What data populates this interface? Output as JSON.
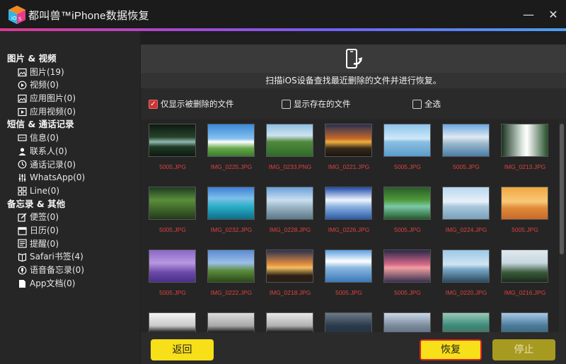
{
  "app": {
    "title": "都叫兽™iPhone数据恢复"
  },
  "colors": {
    "accent_yellow": "#f7df19",
    "filename_red": "#e04040",
    "sidebar_bg": "#262626",
    "main_bg": "#252525"
  },
  "sidebar": {
    "groups": [
      {
        "label": "图片 & 视频",
        "items": [
          {
            "label": "图片(19)",
            "icon": "image-icon"
          },
          {
            "label": "视频(0)",
            "icon": "play-circle-icon"
          },
          {
            "label": "应用图片(0)",
            "icon": "app-image-icon"
          },
          {
            "label": "应用视频(0)",
            "icon": "app-video-icon"
          }
        ]
      },
      {
        "label": "短信 & 通话记录",
        "items": [
          {
            "label": "信息(0)",
            "icon": "message-icon"
          },
          {
            "label": "联系人(0)",
            "icon": "person-icon"
          },
          {
            "label": "通话记录(0)",
            "icon": "clock-icon"
          },
          {
            "label": "WhatsApp(0)",
            "icon": "sliders-icon"
          },
          {
            "label": "Line(0)",
            "icon": "grid-icon"
          }
        ]
      },
      {
        "label": "备忘录 & 其他",
        "items": [
          {
            "label": "便签(0)",
            "icon": "note-edit-icon"
          },
          {
            "label": "日历(0)",
            "icon": "calendar-icon"
          },
          {
            "label": "提醒(0)",
            "icon": "reminder-icon"
          },
          {
            "label": "Safari书签(4)",
            "icon": "book-icon"
          },
          {
            "label": "语音备忘录(0)",
            "icon": "voice-memo-icon"
          },
          {
            "label": "App文档(0)",
            "icon": "document-icon"
          }
        ]
      }
    ]
  },
  "main": {
    "subtitle": "扫描iOS设备查找最近删除的文件并进行恢复。",
    "filters": {
      "only_deleted": {
        "label": "仅显示被删除的文件",
        "checked": true
      },
      "show_existing": {
        "label": "显示存在的文件",
        "checked": false
      },
      "select_all": {
        "label": "全选",
        "checked": false
      }
    },
    "files": [
      "5005.JPG",
      "IMG_0225.JPG",
      "IMG_0233.PNG",
      "IMG_0221.JPG",
      "5005.JPG",
      "5005.JPG",
      "IMG_0213.JPG",
      "5005.JPG",
      "IMG_0232.JPG",
      "IMG_0228.JPG",
      "IMG_0226.JPG",
      "5005.JPG",
      "IMG_0224.JPG",
      "5005.JPG",
      "5005.JPG",
      "IMG_0222.JPG",
      "IMG_0218.JPG",
      "5005.JPG",
      "5005.JPG",
      "IMG_0220.JPG",
      "IMG_0216.JPG",
      "",
      "",
      "",
      "",
      "",
      "",
      ""
    ],
    "buttons": {
      "back": "返回",
      "recover": "恢复",
      "stop": "停止"
    }
  }
}
